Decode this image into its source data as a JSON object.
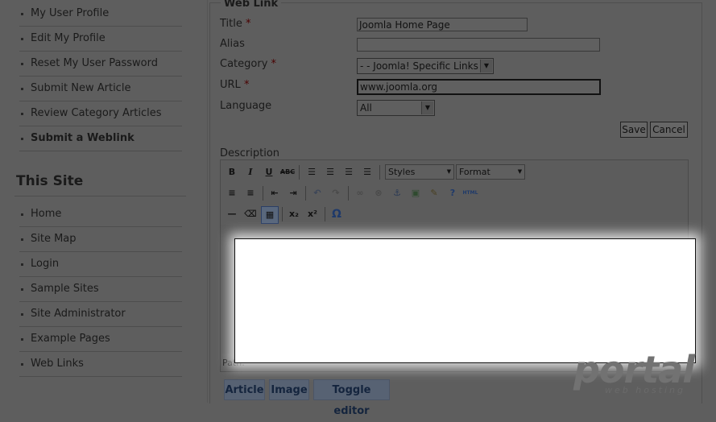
{
  "sidebar": {
    "user_menu": [
      {
        "label": "My User Profile"
      },
      {
        "label": "Edit My Profile"
      },
      {
        "label": "Reset My User Password"
      },
      {
        "label": "Submit New Article"
      },
      {
        "label": "Review Category Articles"
      },
      {
        "label": "Submit a Weblink"
      }
    ],
    "section_title": "This Site",
    "site_menu": [
      {
        "label": "Home"
      },
      {
        "label": "Site Map"
      },
      {
        "label": "Login"
      },
      {
        "label": "Sample Sites"
      },
      {
        "label": "Site Administrator"
      },
      {
        "label": "Example Pages"
      },
      {
        "label": "Web Links"
      }
    ]
  },
  "form": {
    "legend": "Web Link",
    "title_label": "Title",
    "title_value": "Joomla Home Page",
    "alias_label": "Alias",
    "alias_value": "",
    "category_label": "Category",
    "category_value": "- - Joomla! Specific Links",
    "url_label": "URL",
    "url_value": "www.joomla.org",
    "language_label": "Language",
    "language_value": "All",
    "required_mark": "*",
    "save_label": "Save",
    "cancel_label": "Cancel",
    "description_label": "Description"
  },
  "editor": {
    "styles_label": "Styles",
    "format_label": "Format",
    "path_label": "Path:",
    "bold": "B",
    "italic": "I",
    "underline": "U",
    "strike": "ABC",
    "html": "HTML",
    "sub": "x₂",
    "sup": "x²",
    "omega": "Ω"
  },
  "bottom_buttons": {
    "article": "Article",
    "image": "Image",
    "toggle": "Toggle editor"
  },
  "watermark": {
    "brand": "portal",
    "sub": "web hosting"
  },
  "colors": {
    "overlay": "#5e5e5e",
    "highlight": "#ffffff",
    "button_blue": "#576273"
  }
}
